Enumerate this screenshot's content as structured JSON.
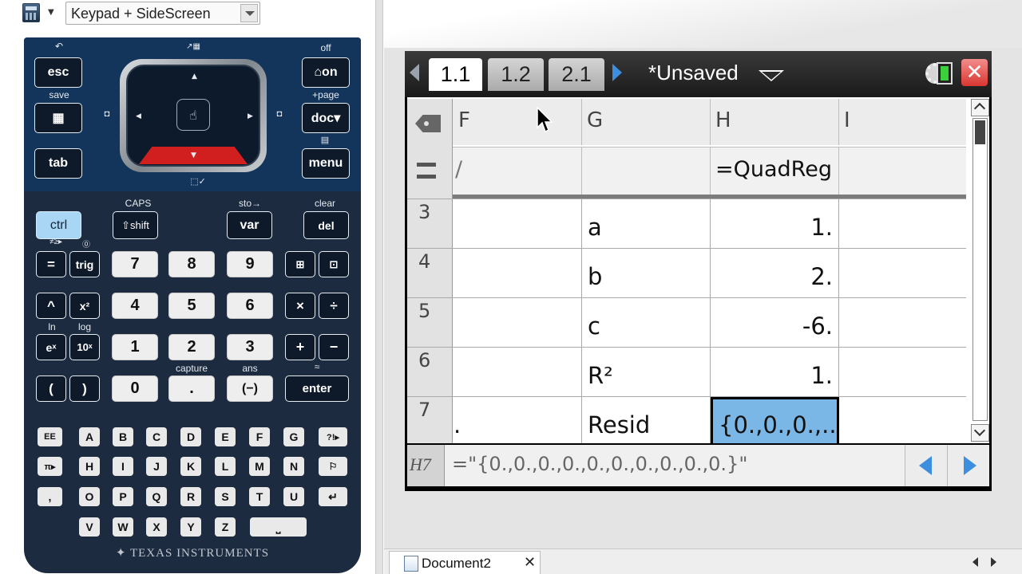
{
  "toolbar": {
    "view_mode": "Keypad + SideScreen",
    "app_icon": "calculator-icon"
  },
  "calculator": {
    "brand": "TEXAS INSTRUMENTS",
    "labels": {
      "undo": "↶",
      "touchpad_top": "↗▦",
      "off": "off",
      "save": "save",
      "page": "+page",
      "caps": "CAPS",
      "sto": "sto→",
      "clear": "clear",
      "capture": "capture",
      "ans": "ans",
      "ln": "ln",
      "log": "log",
      "neq": "≠≥▸",
      "question": "⓪",
      "approx": "≈"
    },
    "keys": {
      "esc": "esc",
      "on": "⌂on",
      "doc": "doc▾",
      "tab": "tab",
      "menu": "menu",
      "ctrl": "ctrl",
      "shift": "⇧shift",
      "var": "var",
      "del": "del",
      "eq": "=",
      "trig": "trig",
      "caret": "^",
      "x2": "x²",
      "ex": "eˣ",
      "tenx": "10ˣ",
      "lparen": "(",
      "rparen": ")",
      "mul": "×",
      "div": "÷",
      "plus": "+",
      "minus": "−",
      "d7": "7",
      "d8": "8",
      "d9": "9",
      "d4": "4",
      "d5": "5",
      "d6": "6",
      "d1": "1",
      "d2": "2",
      "d3": "3",
      "d0": "0",
      "dot": ".",
      "neg": "(−)",
      "enter": "enter",
      "ee": "EE",
      "pi": "π▸",
      "comma": ",",
      "space": "⎵",
      "return": "↵",
      "flag": "⚐",
      "qmark": "?!▸"
    },
    "alpha_rows": [
      [
        "A",
        "B",
        "C",
        "D",
        "E",
        "F",
        "G"
      ],
      [
        "H",
        "I",
        "J",
        "K",
        "L",
        "M",
        "N"
      ],
      [
        "O",
        "P",
        "Q",
        "R",
        "S",
        "T",
        "U"
      ],
      [
        "V",
        "W",
        "X",
        "Y",
        "Z"
      ]
    ]
  },
  "screen": {
    "tabs": [
      {
        "label": "1.1",
        "active": true
      },
      {
        "label": "1.2",
        "active": false
      },
      {
        "label": "2.1",
        "active": false
      }
    ],
    "doc_title": "*Unsaved",
    "close_label": "✕"
  },
  "sheet": {
    "columns": [
      "F",
      "G",
      "H",
      "I"
    ],
    "formula_row": {
      "F": "/",
      "G": "",
      "H": "=QuadReg",
      "I": ""
    },
    "rows": [
      {
        "num": "3",
        "F": "",
        "G": "a",
        "H": "1.",
        "I": ""
      },
      {
        "num": "4",
        "F": "",
        "G": "b",
        "H": "2.",
        "I": ""
      },
      {
        "num": "5",
        "F": "",
        "G": "c",
        "H": "-6.",
        "I": ""
      },
      {
        "num": "6",
        "F": "",
        "G": "R²",
        "H": "1.",
        "I": ""
      },
      {
        "num": "7",
        "F": ".",
        "G": "Resid",
        "H": "{0.,0.,0.,...",
        "I": ""
      }
    ],
    "selected_cell": "H7"
  },
  "entry_line": {
    "cell_ref": "H7",
    "expression": "=\"{0.,0.,0.,0.,0.,0.,0.,0.,0.,0.}\""
  },
  "doc_tabbar": {
    "tab_label": "Document2",
    "close_label": "✕"
  }
}
